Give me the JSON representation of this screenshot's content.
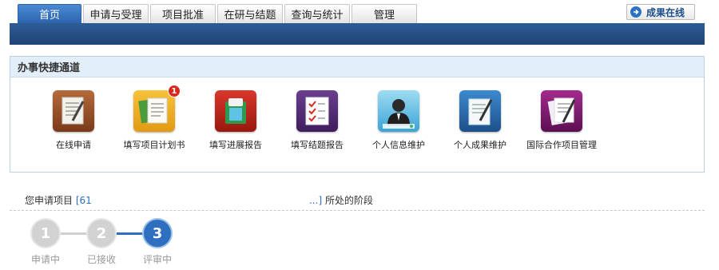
{
  "tabs": [
    {
      "label": "首页",
      "active": true
    },
    {
      "label": "申请与受理",
      "active": false
    },
    {
      "label": "项目批准",
      "active": false
    },
    {
      "label": "在研与结题",
      "active": false
    },
    {
      "label": "查询与统计",
      "active": false
    },
    {
      "label": "管理",
      "active": false
    }
  ],
  "results_button": {
    "label": "成果在线",
    "icon": "arrow-right-circle-icon"
  },
  "quick_panel": {
    "title": "办事快捷通道",
    "shortcuts": [
      {
        "label": "在线申请",
        "icon": "pen-paper-icon"
      },
      {
        "label": "填写项目计划书",
        "icon": "plan-book-icon",
        "badge": "1"
      },
      {
        "label": "填写进展报告",
        "icon": "progress-report-icon"
      },
      {
        "label": "填写结题报告",
        "icon": "checklist-icon"
      },
      {
        "label": "个人信息维护",
        "icon": "person-icon"
      },
      {
        "label": "个人成果维护",
        "icon": "document-pen-icon"
      },
      {
        "label": "国际合作项目管理",
        "icon": "intl-project-icon"
      }
    ]
  },
  "project_stage": {
    "prefix": "您申请项目",
    "code_start": "[61",
    "code_end": "...]",
    "suffix": "所处的阶段",
    "steps": [
      {
        "number": "1",
        "label": "申请中",
        "state": "done"
      },
      {
        "number": "2",
        "label": "已接收",
        "state": "done"
      },
      {
        "number": "3",
        "label": "评审中",
        "state": "current"
      }
    ]
  },
  "colors": {
    "accent": "#2b64ad",
    "navbar": "#1f4476",
    "panel_header": "#e2eef9",
    "step_current": "#2f6fc0",
    "step_done": "#d2d2d2",
    "badge": "#d8291f"
  }
}
